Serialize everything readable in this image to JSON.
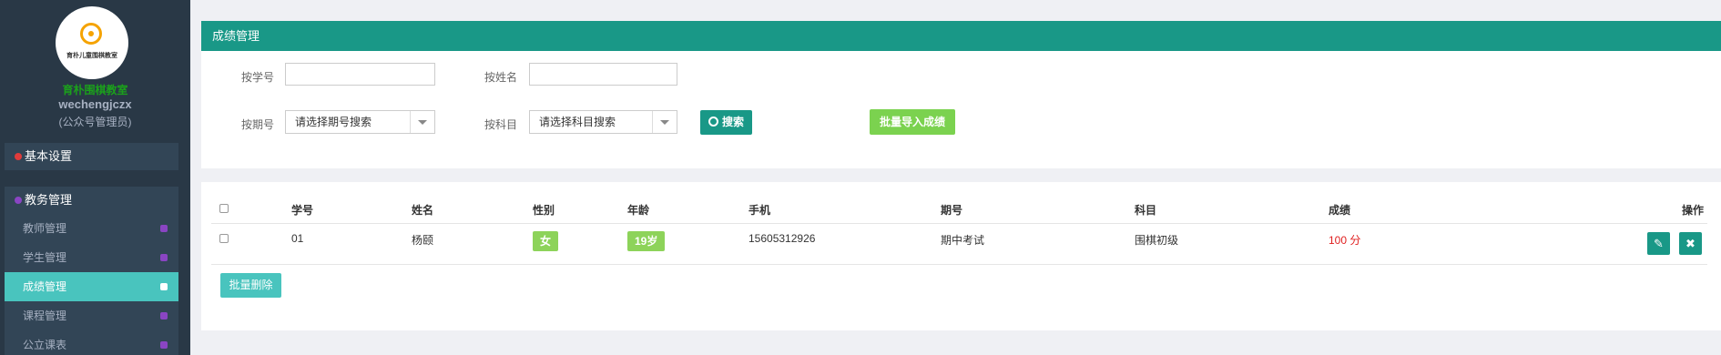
{
  "sidebar": {
    "logo_text": "育朴儿童围棋教室",
    "brand": "育朴围棋教室",
    "username": "wechengjczx",
    "role": "(公众号管理员)",
    "groups": [
      {
        "title": "基本设置",
        "icon": "gear-icon",
        "color": "#e03b3b"
      },
      {
        "title": "教务管理",
        "icon": "grid-icon",
        "color": "#8a45c3"
      }
    ],
    "items": [
      {
        "label": "教师管理",
        "icon": "user-icon"
      },
      {
        "label": "学生管理",
        "icon": "users-icon"
      },
      {
        "label": "成绩管理",
        "icon": "book-icon",
        "active": true
      },
      {
        "label": "课程管理",
        "icon": "graduation-cap-icon"
      },
      {
        "label": "公立课表",
        "icon": "circle-icon"
      }
    ]
  },
  "search": {
    "title": "成绩管理",
    "student_no_label": "按学号",
    "student_no_value": "",
    "name_label": "按姓名",
    "name_value": "",
    "period_label": "按期号",
    "period_selected": "请选择期号搜索",
    "subject_label": "按科目",
    "subject_selected": "请选择科目搜索",
    "search_button": "搜索",
    "import_button": "批量导入成绩"
  },
  "table": {
    "columns": [
      "学号",
      "姓名",
      "性别",
      "年龄",
      "手机",
      "期号",
      "科目",
      "成绩",
      "操作"
    ],
    "rows": [
      {
        "student_no": "01",
        "name": "杨颐",
        "gender": "女",
        "age": "19岁",
        "phone": "15605312926",
        "period": "期中考试",
        "subject": "围棋初级",
        "score": "100 分"
      }
    ],
    "bulk_delete": "批量删除"
  },
  "colors": {
    "primary": "#199887",
    "accent": "#49c4be",
    "badge": "#8dd35a",
    "import": "#7bd24f",
    "score": "#e02020",
    "sidebar": "#293846"
  }
}
